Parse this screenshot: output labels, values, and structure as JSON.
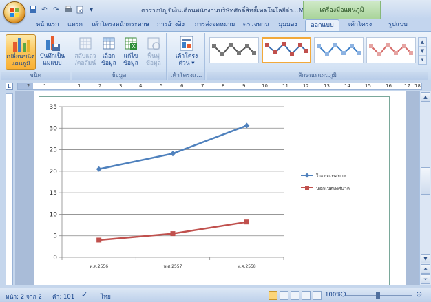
{
  "title_bar": {
    "document_title": "ตารางบัญชีเงินเดือนพนักงานบริษัทศักดิ์สิทธิ์เทคโนโลยีจำ...M",
    "context_tab_title": "เครื่องมือแผนภูมิ",
    "quick_access_icons": [
      "save-icon",
      "undo-icon",
      "redo-icon",
      "print-icon",
      "print-preview-icon",
      "customize-icon"
    ]
  },
  "tabs": [
    {
      "label": "หน้าแรก",
      "active": false
    },
    {
      "label": "แทรก",
      "active": false
    },
    {
      "label": "เค้าโครงหน้ากระดาษ",
      "active": false
    },
    {
      "label": "การอ้างอิง",
      "active": false
    },
    {
      "label": "การส่งจดหมาย",
      "active": false
    },
    {
      "label": "ตรวจทาน",
      "active": false
    },
    {
      "label": "มุมมอง",
      "active": false
    },
    {
      "label": "ออกแบบ",
      "active": true
    },
    {
      "label": "เค้าโครง",
      "active": false
    },
    {
      "label": "รูปแบบ",
      "active": false
    }
  ],
  "ribbon": {
    "groups": {
      "type": {
        "label": "ชนิด",
        "change_chart_type": "เปลี่ยนชนิด แผนภูมิ",
        "save_as_template": "บันทึกเป็น แม่แบบ"
      },
      "data": {
        "label": "ข้อมูล",
        "switch_row_column": "สลับแถว /คอลัมน์",
        "select_data": "เลือก ข้อมูล",
        "edit_data": "แก้ไข ข้อมูล",
        "refresh_data": "ฟื้นฟู ข้อมูล"
      },
      "layouts": {
        "label": "เค้าโครงแ...",
        "quick_layout": "เค้าโครง ด่วน ▾"
      },
      "styles": {
        "label": "ลักษณะแผนภูมิ",
        "thumbnail_count": 4,
        "selected_index": 1
      }
    }
  },
  "ruler": {
    "numbers": [
      "1",
      "2",
      "1",
      "2",
      "3",
      "4",
      "5",
      "6",
      "7",
      "8",
      "9",
      "10",
      "11",
      "12",
      "13",
      "14",
      "15",
      "16",
      "17",
      "18"
    ]
  },
  "chart_data": {
    "type": "line",
    "categories": [
      "พ.ศ.2556",
      "พ.ศ.2557",
      "พ.ศ.2558"
    ],
    "series": [
      {
        "name": "ในเขตเทศบาล",
        "values": [
          20.5,
          24.1,
          30.6
        ],
        "color": "#4f81bd",
        "marker": "diamond"
      },
      {
        "name": "นอกเขตเทศบาล",
        "values": [
          4.0,
          5.5,
          8.2
        ],
        "color": "#c0504d",
        "marker": "square"
      }
    ],
    "ylim": [
      0,
      35
    ],
    "yticks": [
      "0",
      "5",
      "10",
      "15",
      "20",
      "25",
      "30",
      "35"
    ],
    "grid": true,
    "legend_position": "right",
    "title": "",
    "xlabel": "",
    "ylabel": ""
  },
  "status_bar": {
    "page": "หน้า: 2 จาก 2",
    "words": "คำ: 101",
    "language": "ไทย",
    "zoom": "100%"
  },
  "colors": {
    "accent": "#15428b",
    "context_tab": "#a9d49a",
    "selected_button": "#fbc55a",
    "series1": "#4f81bd",
    "series2": "#c0504d"
  }
}
